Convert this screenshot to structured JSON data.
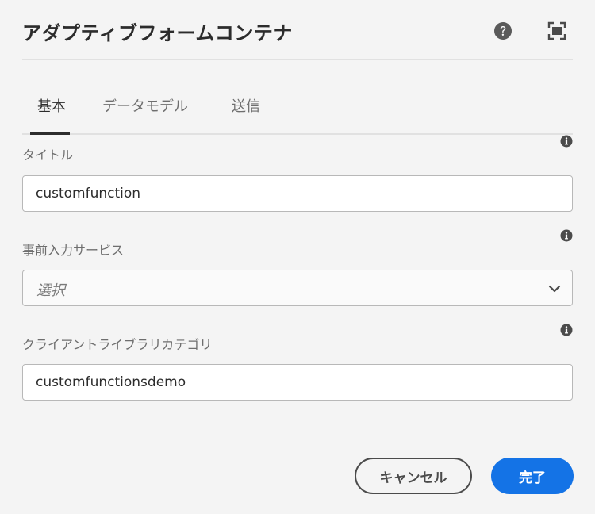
{
  "dialog": {
    "title": "アダプティブフォームコンテナ",
    "help_icon": "help-circle-icon",
    "fullscreen_icon": "fullscreen-icon"
  },
  "tabs": [
    {
      "label": "基本",
      "active": true
    },
    {
      "label": "データモデル",
      "active": false
    },
    {
      "label": "送信",
      "active": false
    }
  ],
  "fields": {
    "title": {
      "label": "タイトル",
      "value": "customfunction"
    },
    "prefill_service": {
      "label": "事前入力サービス",
      "placeholder": "選択"
    },
    "client_library": {
      "label": "クライアントライブラリカテゴリ",
      "value": "customfunctionsdemo"
    }
  },
  "buttons": {
    "cancel": "キャンセル",
    "done": "完了"
  },
  "colors": {
    "accent": "#1473e6",
    "background": "#f4f4f4",
    "text": "#2c2c2c"
  }
}
